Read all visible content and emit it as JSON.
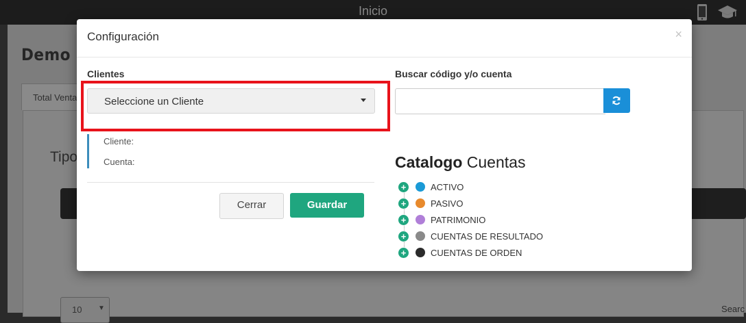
{
  "topbar": {
    "title": "Inicio",
    "icons": [
      "mobile-phone-icon",
      "graduation-cap-icon"
    ]
  },
  "background": {
    "page_title": "Demo P",
    "tab_label": "Total Venta",
    "section_title": "Tipo",
    "page_size": "10",
    "search_label": "Searc"
  },
  "modal": {
    "title": "Configuración",
    "close_symbol": "×",
    "clientes_label": "Clientes",
    "cliente_select": {
      "value": "Seleccione un Cliente"
    },
    "info": {
      "cliente_label": "Cliente:",
      "cuenta_label": "Cuenta:"
    },
    "buttons": {
      "cerrar": "Cerrar",
      "guardar": "Guardar"
    },
    "search": {
      "label": "Buscar código y/o cuenta",
      "value": ""
    },
    "catalog": {
      "title_bold": "Catalogo",
      "title_rest": "Cuentas",
      "items": [
        {
          "label": "ACTIVO",
          "color": "#1a9ad6"
        },
        {
          "label": "PASIVO",
          "color": "#e88a2d"
        },
        {
          "label": "PATRIMONIO",
          "color": "#b07fd8"
        },
        {
          "label": "CUENTAS DE RESULTADO",
          "color": "#8a8a8a"
        },
        {
          "label": "CUENTAS DE ORDEN",
          "color": "#2b2b2b"
        }
      ]
    }
  },
  "colors": {
    "highlight": "#e8131b",
    "primary": "#1fa67f",
    "refresh": "#1a8fd8",
    "info_border": "#3c8dbc"
  }
}
